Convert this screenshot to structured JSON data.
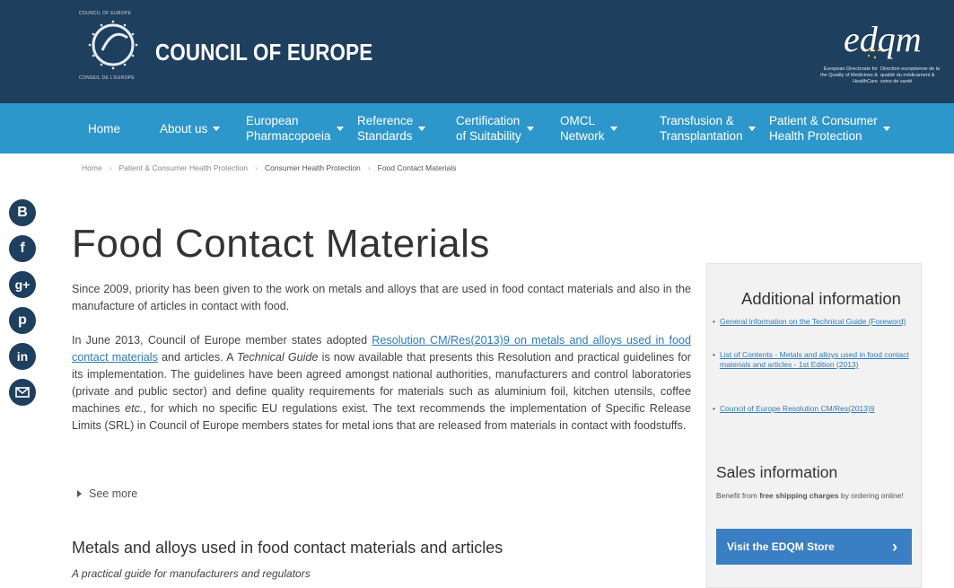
{
  "header": {
    "logo_top_text": "COUNCIL OF EUROPE",
    "logo_bottom_text": "CONSEIL DE L'EUROPE",
    "org_name": "COUNCIL OF EUROPE",
    "edqm_logo": "edqm",
    "edqm_tagline_en": "European Directorate for the Quality of Medicines & HealthCare",
    "edqm_tagline_fr": "Direction européenne de la qualité du médicament & soins de santé",
    "colors": {
      "header_bg": "#1f3f5e",
      "nav_bg": "#2d97cc",
      "accent": "#3a7ec3"
    }
  },
  "nav": {
    "items": [
      {
        "label": "Home"
      },
      {
        "label": "About us"
      },
      {
        "label": "European\nPharmacopoeia"
      },
      {
        "label": "Reference\nStandards"
      },
      {
        "label": "Certification\nof Suitability"
      },
      {
        "label": "OMCL\nNetwork"
      },
      {
        "label": "Transfusion &\nTransplantation"
      },
      {
        "label": "Patient & Consumer\nHealth Protection"
      }
    ]
  },
  "breadcrumb": {
    "items": [
      {
        "label": "Home"
      },
      {
        "label": "Patient & Consumer Health Protection"
      },
      {
        "label": "Consumer Health Protection"
      },
      {
        "label": "Food Contact Materials"
      }
    ]
  },
  "social": {
    "icons": [
      "blogger-icon",
      "facebook-icon",
      "google-plus-icon",
      "pinterest-icon",
      "linkedin-icon",
      "email-icon"
    ]
  },
  "main": {
    "title": "Food Contact Materials",
    "para1": "Since 2009, priority has been given to the work on metals and alloys that are used in food contact materials and also in the manufacture of articles in contact with food.",
    "para2_before": "In June 2013, Council of Europe member states adopted ",
    "para2_link": "Resolution CM/Res(2013)9 on metals and alloys used in food contact materials",
    "para2_mid": " and articles. A ",
    "para2_italic": "Technical Guide",
    "para2_after": " is now available that presents this Resolution and practical guidelines for its implementation. The guidelines have been agreed amongst national authorities, manufacturers and control laboratories (private and public sector) and define quality requirements for materials such as aluminium foil, kitchen utensils, coffee machines ",
    "para2_etc": "etc.",
    "para2_end": ", for which no specific EU regulations exist. The text recommends the implementation of Specific Release Limits (SRL) in Council of Europe members states for metal ions that are released from materials in contact with foodstuffs.",
    "see_more": "See more",
    "subheading": "Metals and alloys used in food contact materials and articles",
    "subtitle": "A practical guide for manufacturers and regulators"
  },
  "sidebar": {
    "title": "Additional information",
    "links": [
      "General information on the Technical Guide (Foreword)",
      "List of Contents - Metals and alloys used in food contact materials and articles - 1st Edition (2013)",
      "Council of Europe Resolution CM/Res(2013)9"
    ],
    "sales_title": "Sales information",
    "sales_desc_before": "Benefit from ",
    "sales_desc_bold": "free shipping charges",
    "sales_desc_after": " by ordering online!",
    "store_button": "Visit the EDQM Store"
  }
}
